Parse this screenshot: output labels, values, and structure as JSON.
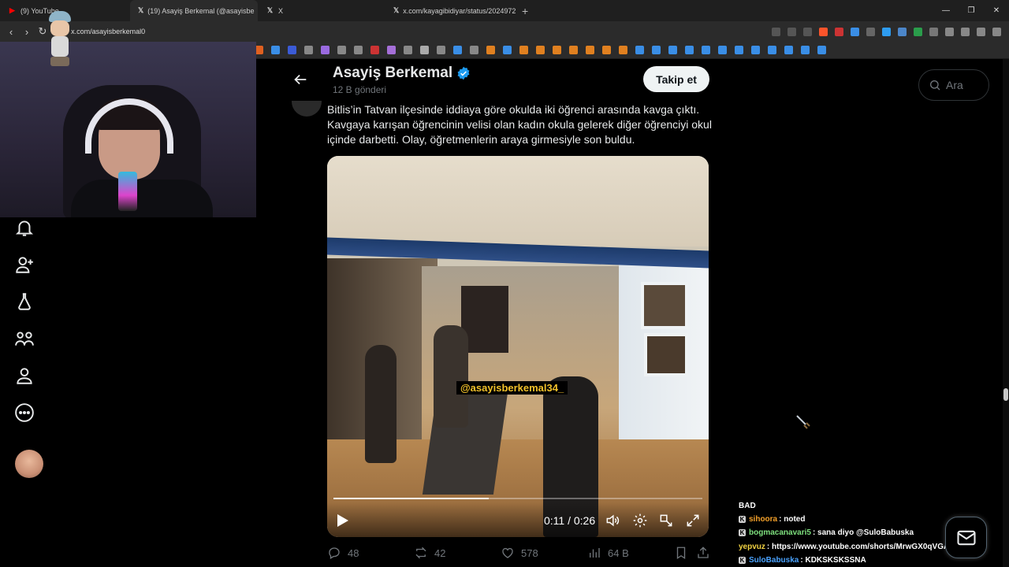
{
  "browser": {
    "tabs": [
      {
        "label": "(9) YouTube",
        "icon": "youtube-icon",
        "color": "#ff0000",
        "active": false
      },
      {
        "label": "(19) Asayiş Berkemal (@asayisbe",
        "icon": "x-logo-icon",
        "color": "#ffffff",
        "active": true
      },
      {
        "label": "X",
        "icon": "x-logo-icon",
        "color": "#ffffff",
        "active": false
      },
      {
        "label": "x.com/kayagibidiyar/status/2024972",
        "icon": "x-logo-icon",
        "color": "#ffffff",
        "active": false
      }
    ],
    "url": "x.com/asayisberkemal0"
  },
  "header": {
    "name": "Asayiş Berkemal",
    "post_count": "12 B gönderi",
    "follow_label": "Takip et"
  },
  "tweet": {
    "text": "Bitlis’in Tatvan ilçesinde iddiaya göre okulda iki öğrenci arasında kavga çıktı. Kavgaya karışan öğrencinin velisi olan kadın okula gelerek diğer öğrenciyi okul içinde darbetti. Olay, öğretmenlerin araya girmesiyle son buldu."
  },
  "video": {
    "watermark": "@asayisberkemal34_",
    "time": "0:11 / 0:26",
    "progress": 0.42
  },
  "actions": {
    "replies": "48",
    "reposts": "42",
    "likes": "578",
    "views": "64 B"
  },
  "search": {
    "placeholder": "Ara"
  },
  "chat": [
    {
      "user": "BAD",
      "user_color": "#ffffff",
      "message": "",
      "badge": false
    },
    {
      "user": "sihoora",
      "user_color": "#f4a12a",
      "message": ": noted",
      "badge": true
    },
    {
      "user": "bogmacanavari5",
      "user_color": "#7ee07e",
      "message": ": sana diyo @SuloBabuska",
      "badge": true
    },
    {
      "user": "yepvuz",
      "user_color": "#f1d243",
      "message": ": https://www.youtube.com/shorts/MrwGX0qVGAA",
      "badge": false
    },
    {
      "user": "SuloBabuska",
      "user_color": "#4aa3ff",
      "message": ": KDKSKSKSSNA",
      "badge": true
    }
  ],
  "colors": {
    "accent": "#1d9bf0",
    "background": "#000000",
    "muted": "#71767b",
    "watermark": "#f3c22a"
  }
}
